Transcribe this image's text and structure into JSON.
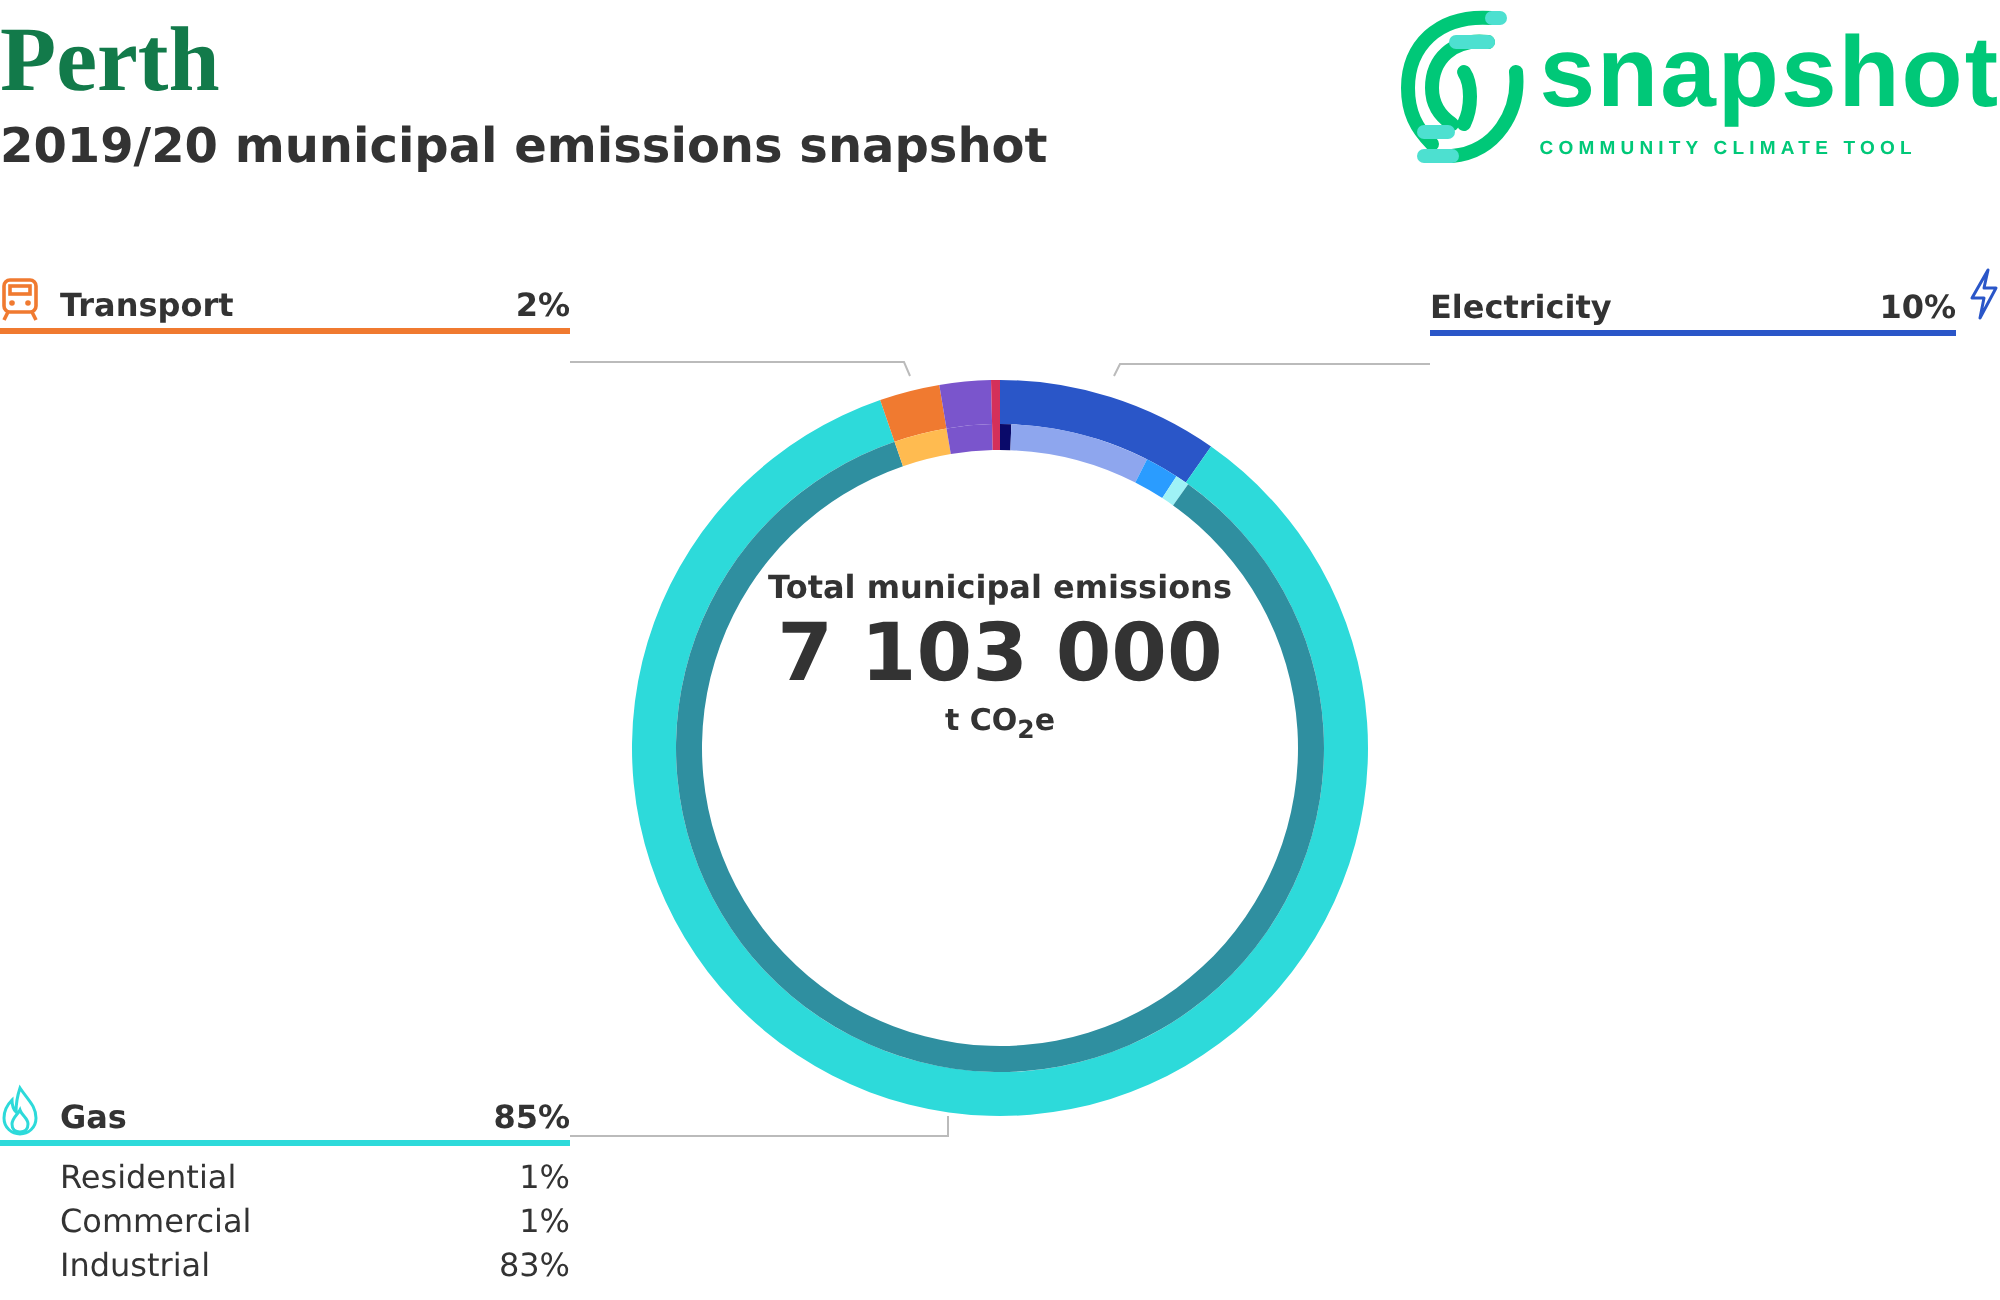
{
  "header": {
    "city": "Perth",
    "subtitle": "2019/20 municipal emissions snapshot"
  },
  "logo": {
    "name": "snapshot",
    "tagline": "COMMUNITY CLIMATE TOOL"
  },
  "total": {
    "label": "Total municipal emissions",
    "value": "7 103 000",
    "unit": "t CO$_{2}$e"
  },
  "transport": {
    "name": "Transport",
    "share": "2%",
    "color": "#f07a30"
  },
  "electricity": {
    "name": "Electricity",
    "share": "10%",
    "color": "#2a56c8"
  },
  "gas": {
    "name": "Gas",
    "share": "85%",
    "color": "#2ddada",
    "subsectors": [
      {
        "name": "Residential",
        "share": "1%"
      },
      {
        "name": "Commercial",
        "share": "1%"
      },
      {
        "name": "Industrial",
        "share": "83%"
      }
    ]
  }
}
